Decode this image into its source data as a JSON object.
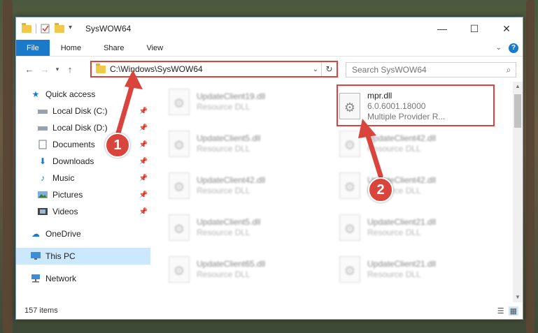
{
  "window": {
    "title": "SysWOW64"
  },
  "ribbon": {
    "tabs": [
      "File",
      "Home",
      "Share",
      "View"
    ]
  },
  "address": {
    "path": "C:\\Windows\\SysWOW64",
    "search_placeholder": "Search SysWOW64"
  },
  "sidebar": {
    "items": [
      {
        "label": "Quick access",
        "icon": "star-icon"
      },
      {
        "label": "Local Disk (C:)",
        "icon": "drive-icon",
        "pinned": true
      },
      {
        "label": "Local Disk (D:)",
        "icon": "drive-icon",
        "pinned": true
      },
      {
        "label": "Documents",
        "icon": "documents-icon",
        "pinned": true
      },
      {
        "label": "Downloads",
        "icon": "download-icon",
        "pinned": true
      },
      {
        "label": "Music",
        "icon": "music-icon",
        "pinned": true
      },
      {
        "label": "Pictures",
        "icon": "pictures-icon",
        "pinned": true
      },
      {
        "label": "Videos",
        "icon": "videos-icon",
        "pinned": true
      },
      {
        "label": "OneDrive",
        "icon": "cloud-icon"
      },
      {
        "label": "This PC",
        "icon": "computer-icon",
        "selected": true
      },
      {
        "label": "Network",
        "icon": "network-icon"
      }
    ]
  },
  "files": {
    "left_column": [
      {
        "name": "UpdateClient19.dll",
        "type": "Resource DLL"
      },
      {
        "name": "UpdateClient5.dll",
        "type": "Resource DLL"
      },
      {
        "name": "UpdateClient42.dll",
        "type": "Resource DLL"
      },
      {
        "name": "UpdateClient5.dll",
        "type": "Resource DLL"
      },
      {
        "name": "UpdateClient65.dll",
        "type": "Resource DLL"
      }
    ],
    "right_column": [
      {
        "name": "mpr.dll",
        "version": "6.0.6001.18000",
        "type": "Multiple Provider R..."
      },
      {
        "name": "UpdateClient42.dll",
        "type": "Resource DLL"
      },
      {
        "name": "UpdateClient42.dll",
        "type": "Resource DLL"
      },
      {
        "name": "UpdateClient21.dll",
        "type": "Resource DLL"
      },
      {
        "name": "UpdateClient21.dll",
        "type": "Resource DLL"
      }
    ]
  },
  "status": {
    "item_count": "157 items"
  },
  "callouts": [
    "1",
    "2"
  ],
  "colors": {
    "accent": "#1979ca",
    "highlight": "#d9443c",
    "selection": "#cce8ff"
  }
}
